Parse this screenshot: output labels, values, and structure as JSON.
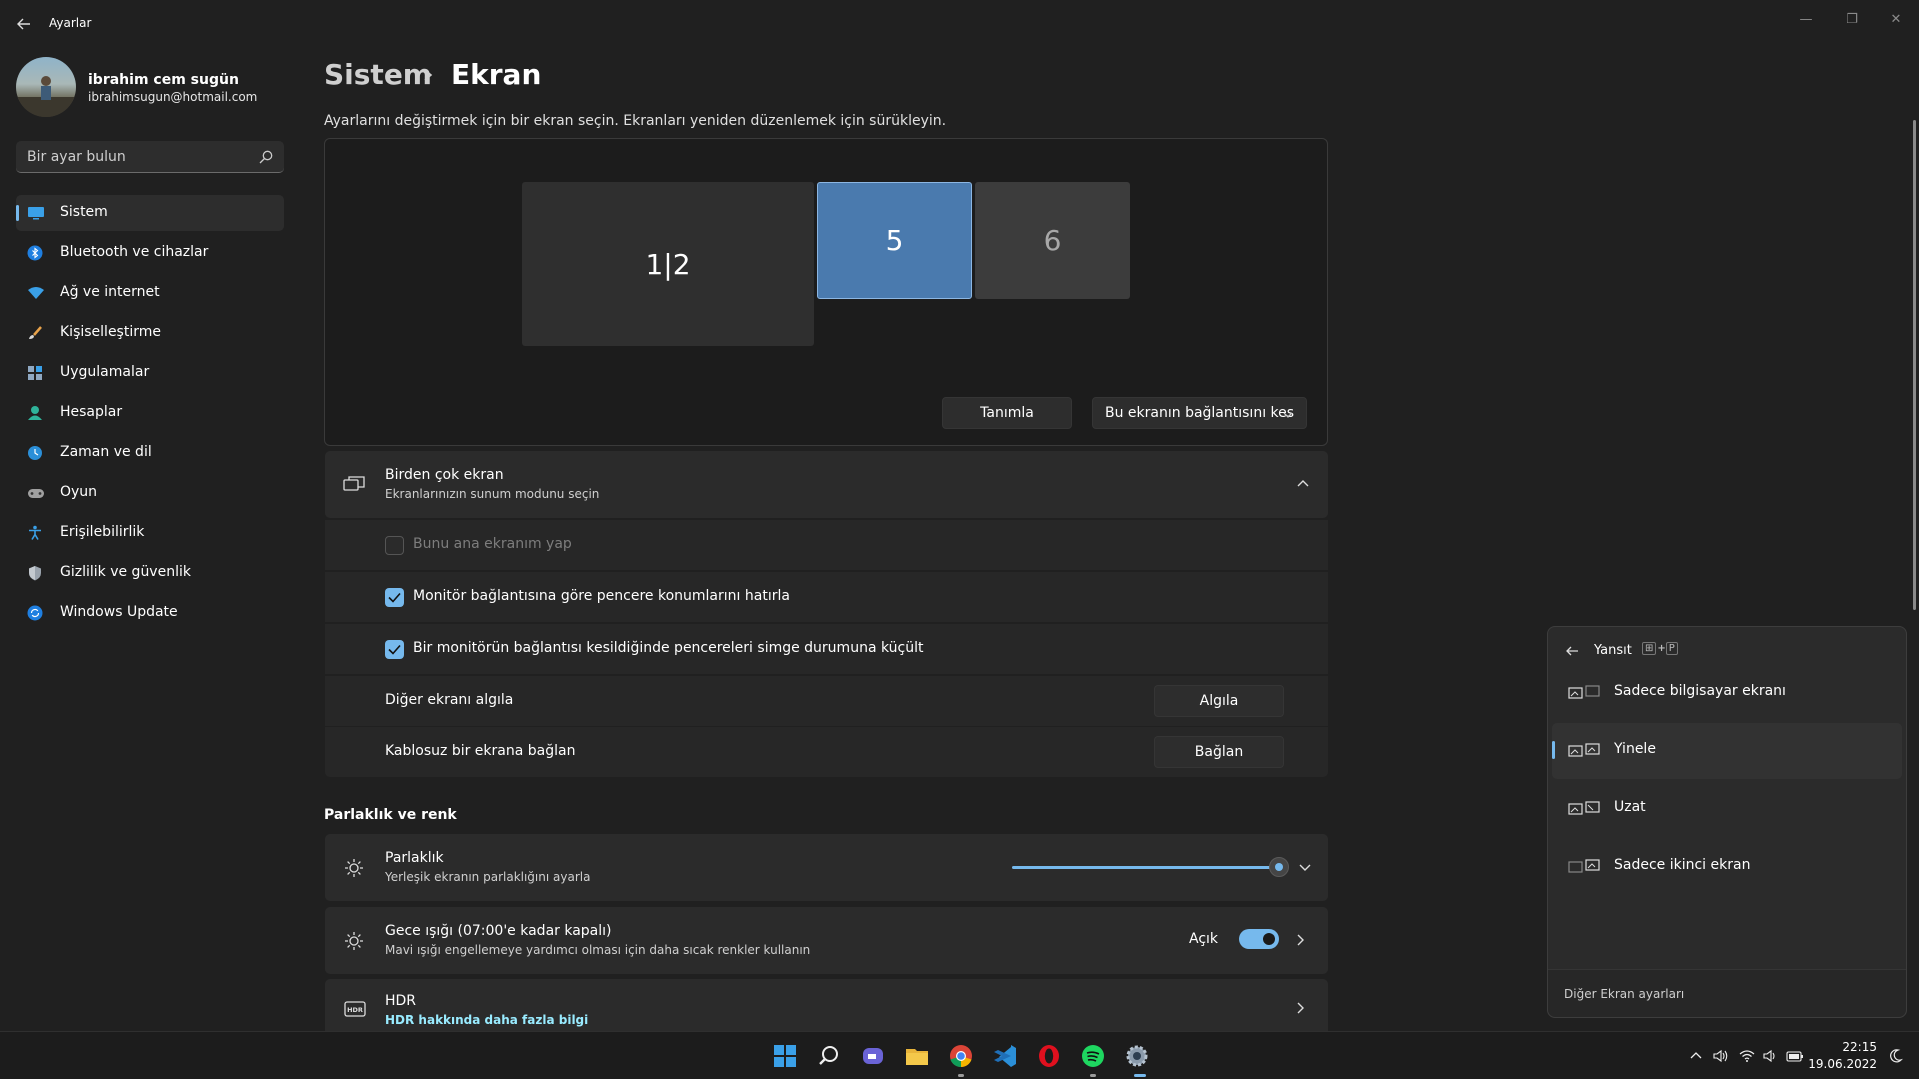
{
  "window": {
    "title": "Ayarlar"
  },
  "user": {
    "name": "ibrahim cem sugün",
    "email": "ibrahimsugun@hotmail.com"
  },
  "search": {
    "placeholder": "Bir ayar bulun"
  },
  "nav": [
    {
      "label": "Sistem",
      "icon": "monitor-icon",
      "active": true
    },
    {
      "label": "Bluetooth ve cihazlar",
      "icon": "bluetooth-icon"
    },
    {
      "label": "Ağ ve internet",
      "icon": "wifi-icon"
    },
    {
      "label": "Kişiselleştirme",
      "icon": "brush-icon"
    },
    {
      "label": "Uygulamalar",
      "icon": "apps-icon"
    },
    {
      "label": "Hesaplar",
      "icon": "person-icon"
    },
    {
      "label": "Zaman ve dil",
      "icon": "globe-clock-icon"
    },
    {
      "label": "Oyun",
      "icon": "gamepad-icon"
    },
    {
      "label": "Erişilebilirlik",
      "icon": "accessibility-icon"
    },
    {
      "label": "Gizlilik ve güvenlik",
      "icon": "shield-icon"
    },
    {
      "label": "Windows Update",
      "icon": "update-icon"
    }
  ],
  "breadcrumb": {
    "parent": "Sistem",
    "current": "Ekran"
  },
  "arrangement": {
    "hint": "Ayarlarını değiştirmek için bir ekran seçin. Ekranları yeniden düzenlemek için sürükleyin.",
    "monitors": [
      "1|2",
      "5",
      "6"
    ],
    "identify_label": "Tanımla",
    "disconnect_label": "Bu ekranın bağlantısını kes"
  },
  "multi_display": {
    "title": "Birden çok ekran",
    "subtitle": "Ekranlarınızın sunum modunu seçin",
    "make_main": {
      "label": "Bunu ana ekranım yap",
      "checked": false
    },
    "remember_positions": {
      "label": "Monitör bağlantısına göre pencere konumlarını hatırla",
      "checked": true
    },
    "minimize_on_disconnect": {
      "label": "Bir monitörün bağlantısı kesildiğinde pencereleri simge durumuna küçült",
      "checked": true
    },
    "detect": {
      "label": "Diğer ekranı algıla",
      "button": "Algıla"
    },
    "wireless": {
      "label": "Kablosuz bir ekrana bağlan",
      "button": "Bağlan"
    }
  },
  "brightness_section": {
    "heading": "Parlaklık ve renk",
    "brightness": {
      "title": "Parlaklık",
      "subtitle": "Yerleşik ekranın parlaklığını ayarla",
      "value": 0.97
    },
    "night_light": {
      "title": "Gece ışığı (07:00'e kadar kapalı)",
      "subtitle": "Mavi ışığı engellemeye yardımcı olması için daha sıcak renkler kullanın",
      "toggle_label": "Açık",
      "on": true
    },
    "hdr": {
      "title": "HDR",
      "link": "HDR hakkında daha fazla bilgi"
    }
  },
  "project": {
    "title": "Yansıt",
    "shortcut": [
      "⊞",
      "+",
      "P"
    ],
    "options": [
      {
        "label": "Sadece bilgisayar ekranı",
        "selected": false
      },
      {
        "label": "Yinele",
        "selected": true
      },
      {
        "label": "Uzat",
        "selected": false
      },
      {
        "label": "Sadece ikinci ekran",
        "selected": false
      }
    ],
    "footer": "Diğer Ekran ayarları"
  },
  "taskbar": {
    "time": "22:15",
    "date": "19.06.2022",
    "apps": [
      "start-icon",
      "search-icon",
      "teams-chat-icon",
      "file-explorer-icon",
      "chrome-icon",
      "vscode-icon",
      "opera-icon",
      "spotify-icon",
      "settings-icon"
    ]
  },
  "colors": {
    "accent": "#76b9ed",
    "background": "#202020",
    "card": "#2b2b2b",
    "selected_monitor": "#4a7aae"
  }
}
